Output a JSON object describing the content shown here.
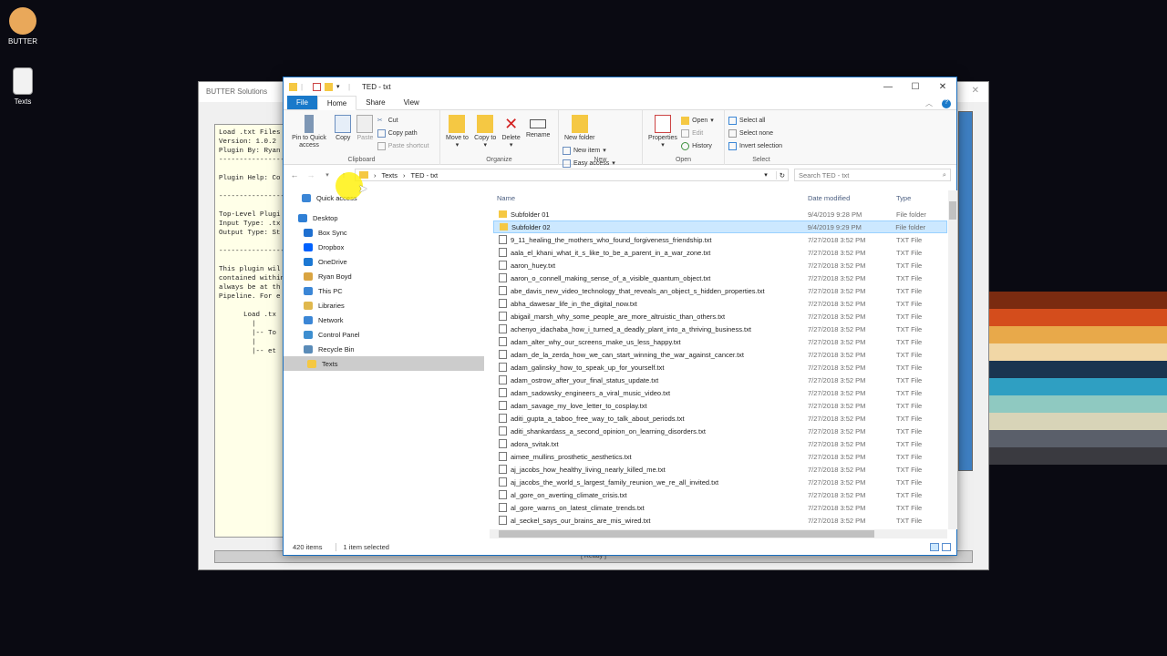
{
  "desktop": {
    "icons": [
      {
        "label": "BUTTER",
        "icon": "pancake-icon"
      },
      {
        "label": "Texts",
        "icon": "text-file-icon"
      }
    ],
    "stripe_colors": [
      "#7a2b10",
      "#d44d1c",
      "#e8a94a",
      "#f1d7a6",
      "#1a3550",
      "#2f9fc2",
      "#8fc9c1",
      "#d8d4b8",
      "#5a5f6a",
      "#3a3a40"
    ]
  },
  "butter": {
    "title": "BUTTER Solutions",
    "text_lines": [
      "Load .txt Files",
      "Version: 1.0.2",
      "Plugin By: Ryan",
      "----------------",
      "",
      "Plugin Help: Co",
      "",
      "----------------",
      "",
      "Top-Level Plugi",
      "Input Type: .tx",
      "Output Type: St",
      "",
      "----------------",
      "",
      "This plugin wil",
      "contained within",
      "always be at th",
      "Pipeline. For e",
      "",
      "      Load .tx",
      "        |",
      "        |-- To",
      "        |",
      "        |-- et"
    ],
    "status": "[ Ready ]"
  },
  "explorer": {
    "title": "TED - txt",
    "tabs": {
      "file": "File",
      "home": "Home",
      "share": "Share",
      "view": "View"
    },
    "ribbon": {
      "clipboard": {
        "label": "Clipboard",
        "pin": "Pin to Quick access",
        "copy": "Copy",
        "paste": "Paste",
        "cut": "Cut",
        "copy_path": "Copy path",
        "paste_shortcut": "Paste shortcut"
      },
      "organize": {
        "label": "Organize",
        "move_to": "Move to",
        "copy_to": "Copy to",
        "delete": "Delete",
        "rename": "Rename"
      },
      "new": {
        "label": "New",
        "new_folder": "New folder",
        "new_item": "New item",
        "easy_access": "Easy access"
      },
      "open": {
        "label": "Open",
        "properties": "Properties",
        "open": "Open",
        "edit": "Edit",
        "history": "History"
      },
      "select": {
        "label": "Select",
        "select_all": "Select all",
        "select_none": "Select none",
        "invert": "Invert selection"
      }
    },
    "address": {
      "crumbs": [
        "Texts",
        "TED - txt"
      ],
      "search_placeholder": "Search TED - txt"
    },
    "nav": [
      {
        "label": "Quick access",
        "icon": "star-icon",
        "color": "#3b86d6"
      },
      {
        "label": "Desktop",
        "icon": "desktop-icon",
        "color": "#2f7fd5"
      },
      {
        "label": "Box Sync",
        "icon": "box-sync-icon",
        "color": "#1e6fd0"
      },
      {
        "label": "Dropbox",
        "icon": "dropbox-icon",
        "color": "#0061fe"
      },
      {
        "label": "OneDrive",
        "icon": "cloud-icon",
        "color": "#1c78d3"
      },
      {
        "label": "Ryan Boyd",
        "icon": "user-icon",
        "color": "#d9a441"
      },
      {
        "label": "This PC",
        "icon": "computer-icon",
        "color": "#3b86d6"
      },
      {
        "label": "Libraries",
        "icon": "library-icon",
        "color": "#e0b84d"
      },
      {
        "label": "Network",
        "icon": "network-icon",
        "color": "#3b86d6"
      },
      {
        "label": "Control Panel",
        "icon": "control-panel-icon",
        "color": "#3d8ed0"
      },
      {
        "label": "Recycle Bin",
        "icon": "recycle-bin-icon",
        "color": "#5a8bb8"
      },
      {
        "label": "Texts",
        "icon": "folder-icon",
        "color": "#f5c843"
      }
    ],
    "columns": {
      "name": "Name",
      "date": "Date modified",
      "type": "Type"
    },
    "files": [
      {
        "name": "Subfolder 01",
        "date": "9/4/2019 9:28 PM",
        "type": "File folder",
        "kind": "folder"
      },
      {
        "name": "Subfolder 02",
        "date": "9/4/2019 9:29 PM",
        "type": "File folder",
        "kind": "folder"
      },
      {
        "name": "9_11_healing_the_mothers_who_found_forgiveness_friendship.txt",
        "date": "7/27/2018 3:52 PM",
        "type": "TXT File",
        "kind": "txt"
      },
      {
        "name": "aala_el_khani_what_it_s_like_to_be_a_parent_in_a_war_zone.txt",
        "date": "7/27/2018 3:52 PM",
        "type": "TXT File",
        "kind": "txt"
      },
      {
        "name": "aaron_huey.txt",
        "date": "7/27/2018 3:52 PM",
        "type": "TXT File",
        "kind": "txt"
      },
      {
        "name": "aaron_o_connell_making_sense_of_a_visible_quantum_object.txt",
        "date": "7/27/2018 3:52 PM",
        "type": "TXT File",
        "kind": "txt"
      },
      {
        "name": "abe_davis_new_video_technology_that_reveals_an_object_s_hidden_properties.txt",
        "date": "7/27/2018 3:52 PM",
        "type": "TXT File",
        "kind": "txt"
      },
      {
        "name": "abha_dawesar_life_in_the_digital_now.txt",
        "date": "7/27/2018 3:52 PM",
        "type": "TXT File",
        "kind": "txt"
      },
      {
        "name": "abigail_marsh_why_some_people_are_more_altruistic_than_others.txt",
        "date": "7/27/2018 3:52 PM",
        "type": "TXT File",
        "kind": "txt"
      },
      {
        "name": "achenyo_idachaba_how_i_turned_a_deadly_plant_into_a_thriving_business.txt",
        "date": "7/27/2018 3:52 PM",
        "type": "TXT File",
        "kind": "txt"
      },
      {
        "name": "adam_alter_why_our_screens_make_us_less_happy.txt",
        "date": "7/27/2018 3:52 PM",
        "type": "TXT File",
        "kind": "txt"
      },
      {
        "name": "adam_de_la_zerda_how_we_can_start_winning_the_war_against_cancer.txt",
        "date": "7/27/2018 3:52 PM",
        "type": "TXT File",
        "kind": "txt"
      },
      {
        "name": "adam_galinsky_how_to_speak_up_for_yourself.txt",
        "date": "7/27/2018 3:52 PM",
        "type": "TXT File",
        "kind": "txt"
      },
      {
        "name": "adam_ostrow_after_your_final_status_update.txt",
        "date": "7/27/2018 3:52 PM",
        "type": "TXT File",
        "kind": "txt"
      },
      {
        "name": "adam_sadowsky_engineers_a_viral_music_video.txt",
        "date": "7/27/2018 3:52 PM",
        "type": "TXT File",
        "kind": "txt"
      },
      {
        "name": "adam_savage_my_love_letter_to_cosplay.txt",
        "date": "7/27/2018 3:52 PM",
        "type": "TXT File",
        "kind": "txt"
      },
      {
        "name": "aditi_gupta_a_taboo_free_way_to_talk_about_periods.txt",
        "date": "7/27/2018 3:52 PM",
        "type": "TXT File",
        "kind": "txt"
      },
      {
        "name": "aditi_shankardass_a_second_opinion_on_learning_disorders.txt",
        "date": "7/27/2018 3:52 PM",
        "type": "TXT File",
        "kind": "txt"
      },
      {
        "name": "adora_svitak.txt",
        "date": "7/27/2018 3:52 PM",
        "type": "TXT File",
        "kind": "txt"
      },
      {
        "name": "aimee_mullins_prosthetic_aesthetics.txt",
        "date": "7/27/2018 3:52 PM",
        "type": "TXT File",
        "kind": "txt"
      },
      {
        "name": "aj_jacobs_how_healthy_living_nearly_killed_me.txt",
        "date": "7/27/2018 3:52 PM",
        "type": "TXT File",
        "kind": "txt"
      },
      {
        "name": "aj_jacobs_the_world_s_largest_family_reunion_we_re_all_invited.txt",
        "date": "7/27/2018 3:52 PM",
        "type": "TXT File",
        "kind": "txt"
      },
      {
        "name": "al_gore_on_averting_climate_crisis.txt",
        "date": "7/27/2018 3:52 PM",
        "type": "TXT File",
        "kind": "txt"
      },
      {
        "name": "al_gore_warns_on_latest_climate_trends.txt",
        "date": "7/27/2018 3:52 PM",
        "type": "TXT File",
        "kind": "txt"
      },
      {
        "name": "al_seckel_says_our_brains_are_mis_wired.txt",
        "date": "7/27/2018 3:52 PM",
        "type": "TXT File",
        "kind": "txt"
      }
    ],
    "selected_index": 1,
    "status": {
      "count": "420 items",
      "selection": "1 item selected"
    }
  }
}
